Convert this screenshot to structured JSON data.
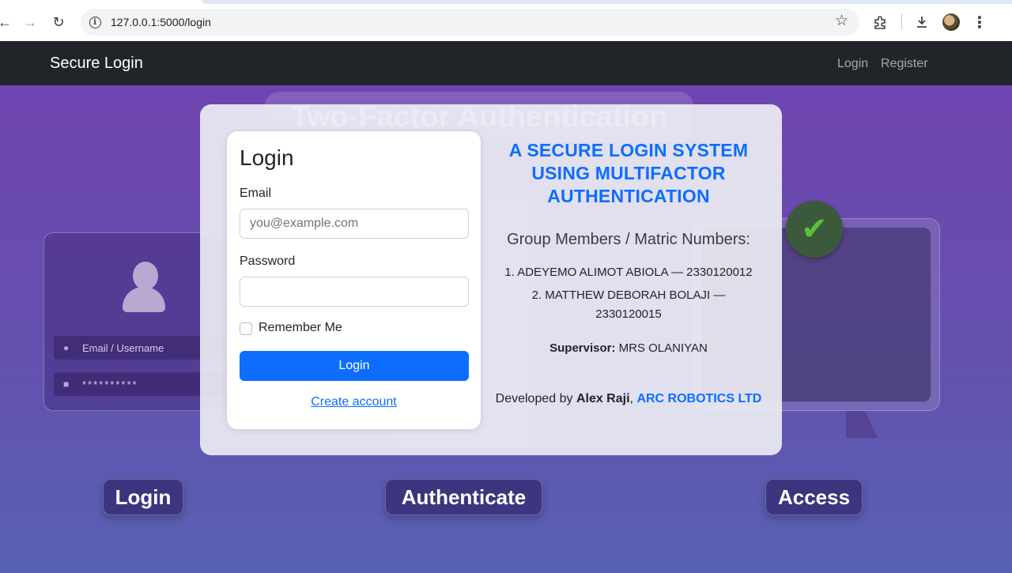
{
  "browser": {
    "url": "127.0.0.1:5000/login"
  },
  "navbar": {
    "brand": "Secure Login",
    "links": [
      "Login",
      "Register"
    ]
  },
  "background": {
    "title": "Two-Factor Authentication",
    "field_email": "Email / Username",
    "field_password": "**********",
    "labels": [
      "Login",
      "Authenticate",
      "Access"
    ]
  },
  "login_form": {
    "title": "Login",
    "email_label": "Email",
    "email_placeholder": "you@example.com",
    "password_label": "Password",
    "remember_label": "Remember Me",
    "submit_label": "Login",
    "create_account": "Create account"
  },
  "info": {
    "title": "A SECURE LOGIN SYSTEM USING MULTIFACTOR AUTHENTICATION",
    "members_heading": "Group Members / Matric Numbers:",
    "members": [
      "1. ADEYEMO ALIMOT ABIOLA — 2330120012",
      "2. MATTHEW DEBORAH BOLAJI — 2330120015"
    ],
    "supervisor_label": "Supervisor:",
    "supervisor_name": "MRS OLANIYAN",
    "developed_prefix": "Developed by",
    "developer": "Alex Raji",
    "separator": ",",
    "company": "ARC ROBOTICS LTD"
  }
}
